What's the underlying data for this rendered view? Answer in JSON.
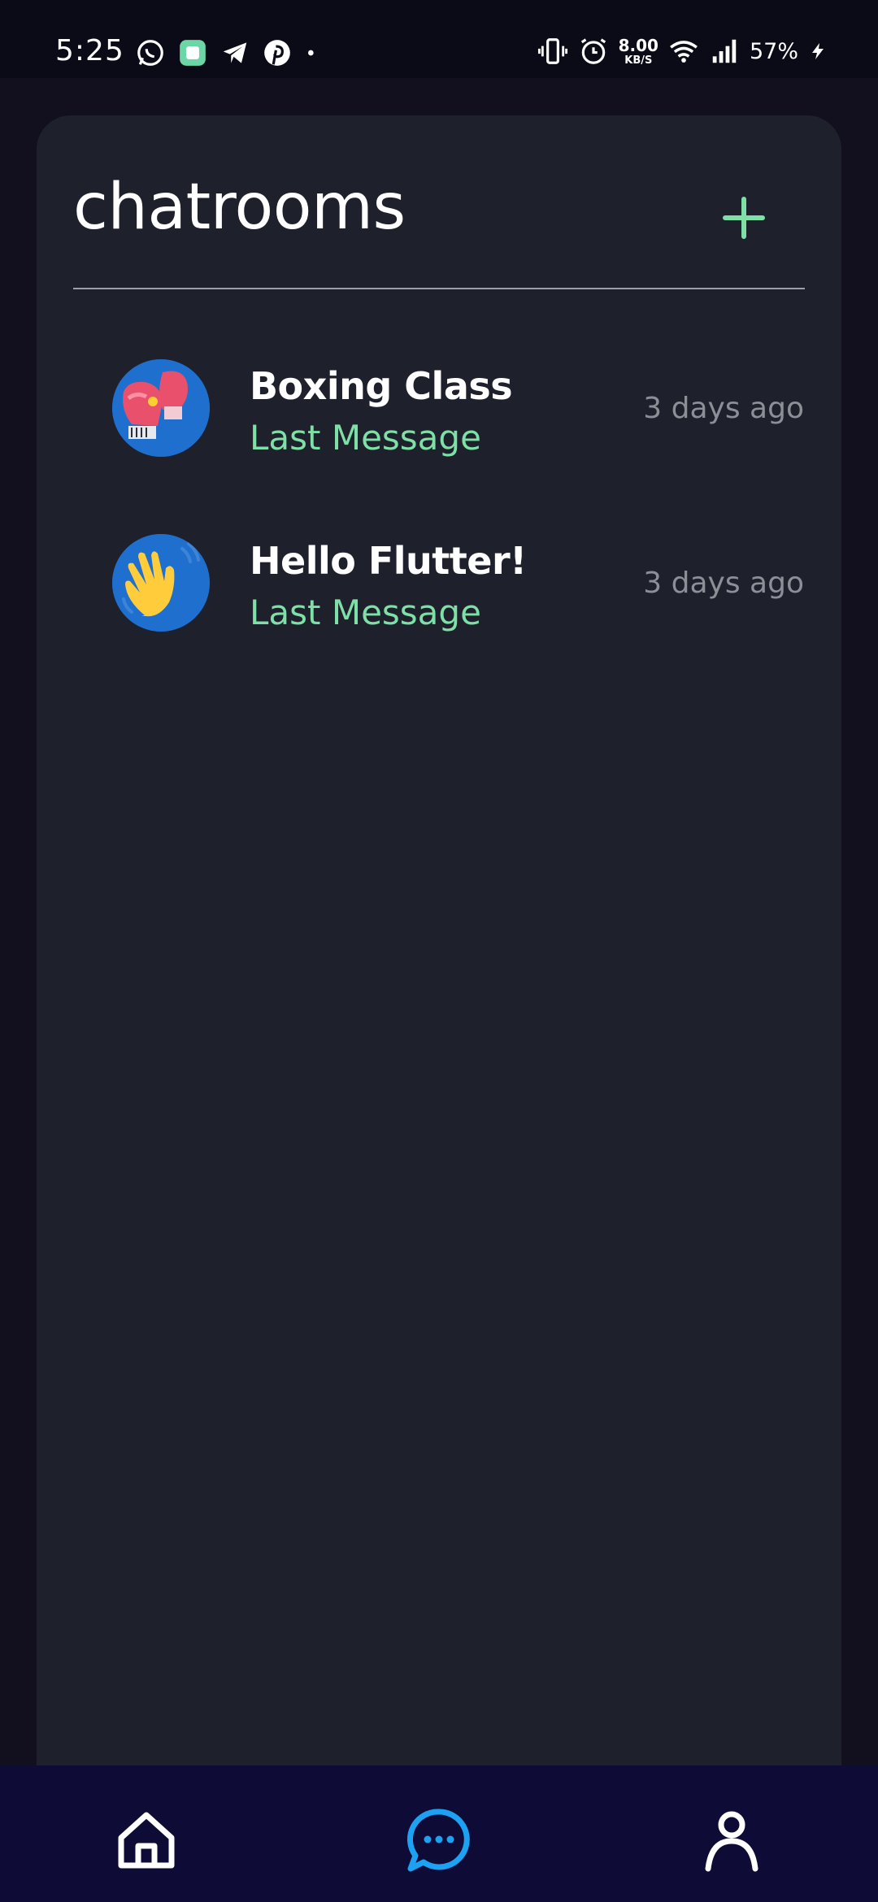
{
  "status_bar": {
    "time": "5:25",
    "net_speed_value": "8.00",
    "net_speed_unit": "KB/S",
    "battery": "57%"
  },
  "header": {
    "title": "chatrooms"
  },
  "rooms": [
    {
      "name": "Boxing Class",
      "last_message": "Last Message",
      "time": "3 days ago",
      "avatar_icon": "boxing-gloves-icon"
    },
    {
      "name": "Hello Flutter!",
      "last_message": "Last Message",
      "time": "3 days ago",
      "avatar_icon": "waving-hand-icon"
    }
  ],
  "bottom_nav": {
    "items": [
      "home-icon",
      "chat-bubble-icon",
      "profile-icon"
    ],
    "active": "chat-bubble-icon"
  },
  "colors": {
    "accent_green": "#7ee0a6",
    "active_nav": "#1da1f2",
    "card_bg": "#1e212c",
    "nav_bg": "#0e0c36"
  }
}
